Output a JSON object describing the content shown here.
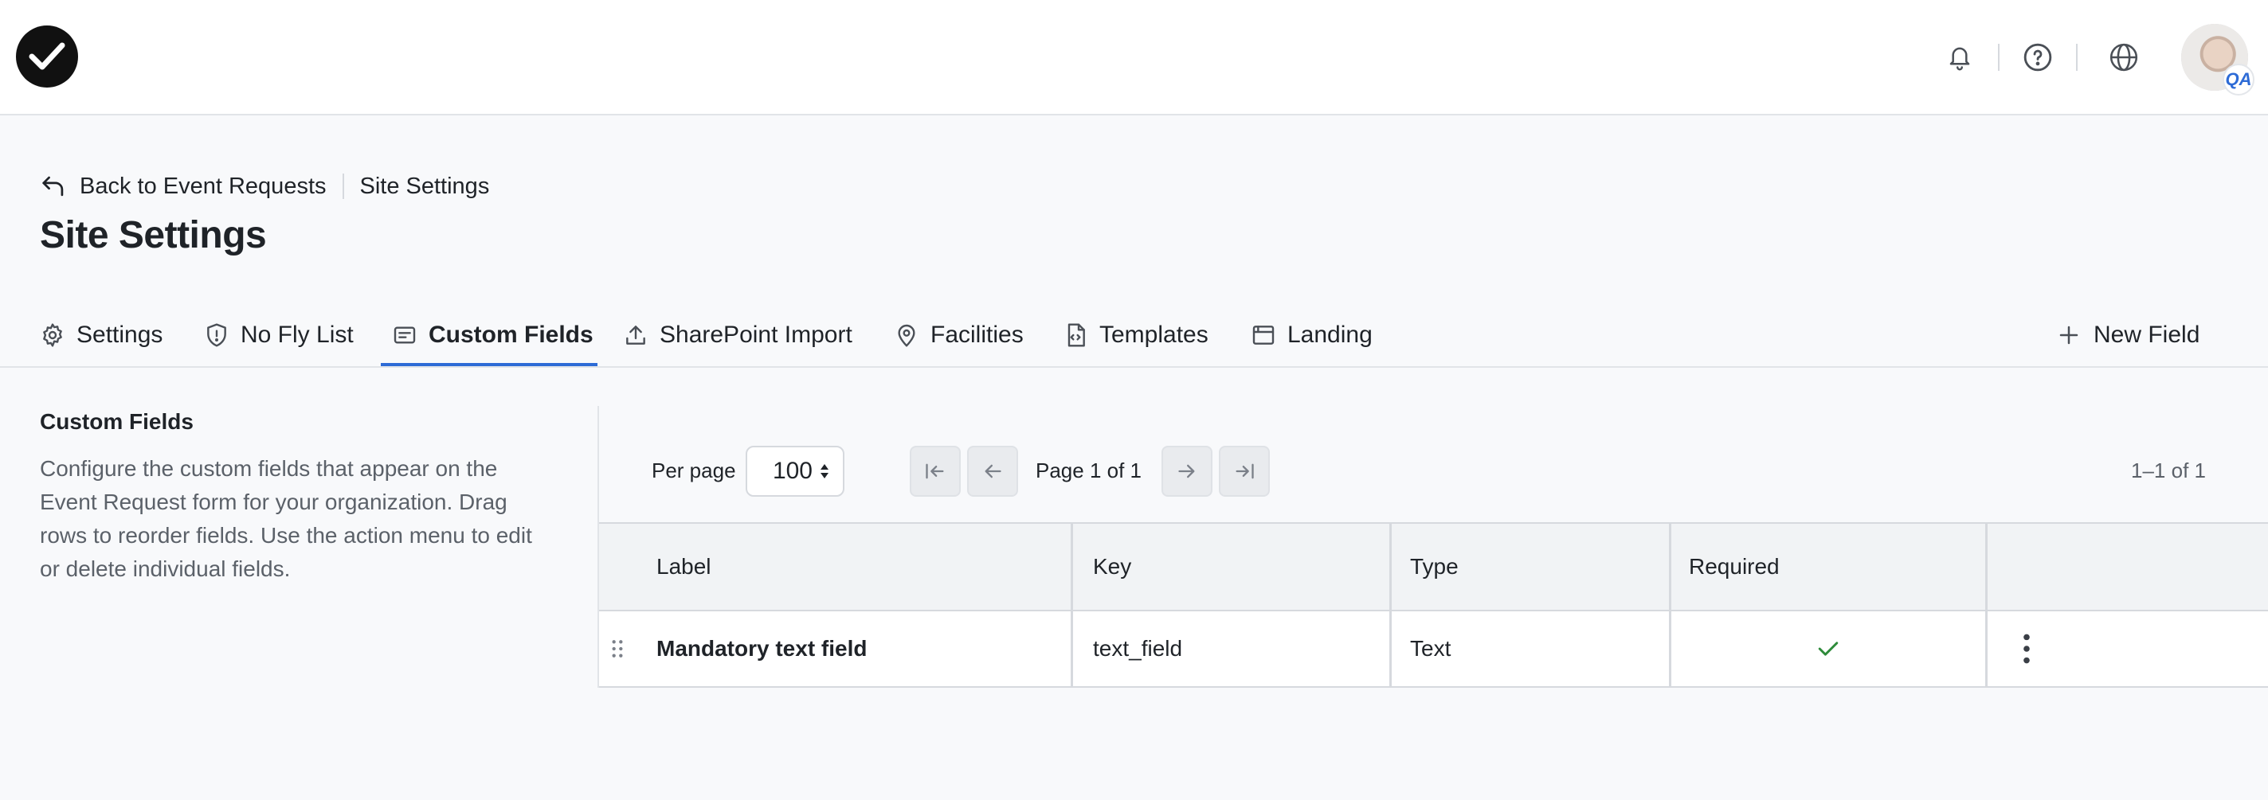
{
  "header": {
    "breadcrumb": {
      "back_label": "Back to Event Requests",
      "current": "Site Settings"
    },
    "title": "Site Settings"
  },
  "topbar": {
    "icons": [
      "checkmark-logo-icon",
      "bell-icon",
      "help-icon",
      "globe-icon"
    ],
    "avatar_badge": "QA"
  },
  "tabs": [
    {
      "label": "Settings",
      "icon": "gear-icon"
    },
    {
      "label": "No Fly List",
      "icon": "shield-alert-icon"
    },
    {
      "label": "Custom Fields",
      "icon": "form-icon",
      "active": true
    },
    {
      "label": "SharePoint Import",
      "icon": "upload-icon"
    },
    {
      "label": "Facilities",
      "icon": "map-pin-icon"
    },
    {
      "label": "Templates",
      "icon": "code-file-icon"
    },
    {
      "label": "Landing",
      "icon": "browser-window-icon"
    }
  ],
  "actions": {
    "new_field": "New Field"
  },
  "section": {
    "title": "Custom Fields",
    "description": "Configure the custom fields that appear on the Event Request form for your organization. Drag rows to reorder fields. Use the action menu to edit or delete individual fields."
  },
  "pagination": {
    "per_page_label": "Per page",
    "per_page_value": "100",
    "page_info": "Page 1 of 1",
    "range": "1–1 of 1"
  },
  "table": {
    "columns": [
      "Label",
      "Key",
      "Type",
      "Required"
    ],
    "rows": [
      {
        "label": "Mandatory text field",
        "key": "text_field",
        "type": "Text",
        "required": true
      }
    ]
  },
  "colors": {
    "accent": "#2d6bd6",
    "check": "#2e8b3a"
  }
}
